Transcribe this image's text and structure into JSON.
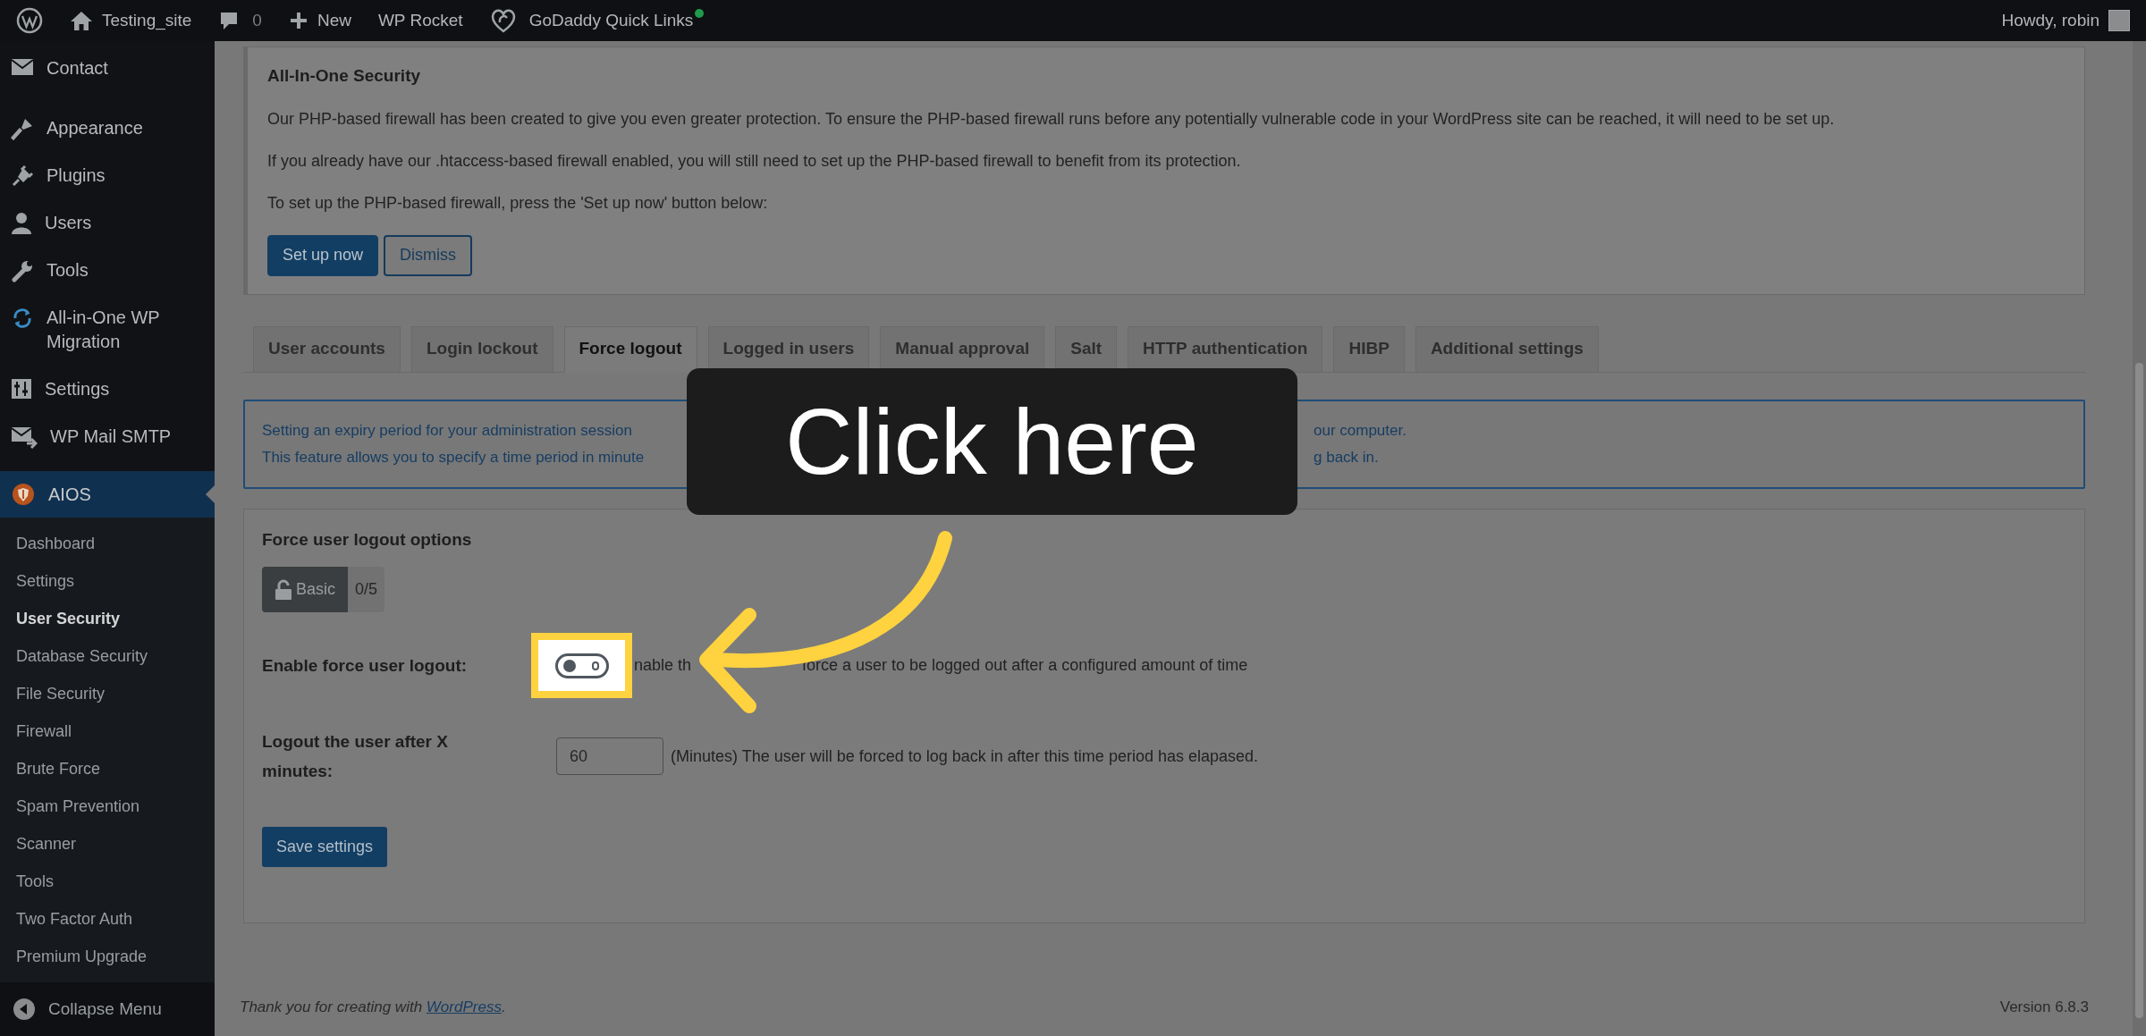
{
  "admin_bar": {
    "site": "Testing_site",
    "comments": "0",
    "new": "New",
    "rocket": "WP Rocket",
    "quick_links": "GoDaddy Quick Links",
    "greeting": "Howdy, robin"
  },
  "sidebar": {
    "items": [
      {
        "label": "Contact",
        "selected": false
      },
      {
        "label": "Appearance",
        "selected": false
      },
      {
        "label": "Plugins",
        "selected": false
      },
      {
        "label": "Users",
        "selected": false
      },
      {
        "label": "Tools",
        "selected": false
      },
      {
        "label": "All-in-One WP Migration",
        "selected": false
      },
      {
        "label": "Settings",
        "selected": false
      },
      {
        "label": "WP Mail SMTP",
        "selected": false
      }
    ],
    "current": {
      "label": "AIOS",
      "selected": true
    },
    "submenu": [
      {
        "label": "Dashboard",
        "selected": false
      },
      {
        "label": "Settings",
        "selected": false
      },
      {
        "label": "User Security",
        "selected": true
      },
      {
        "label": "Database Security",
        "selected": false
      },
      {
        "label": "File Security",
        "selected": false
      },
      {
        "label": "Firewall",
        "selected": false
      },
      {
        "label": "Brute Force",
        "selected": false
      },
      {
        "label": "Spam Prevention",
        "selected": false
      },
      {
        "label": "Scanner",
        "selected": false
      },
      {
        "label": "Tools",
        "selected": false
      },
      {
        "label": "Two Factor Auth",
        "selected": false
      },
      {
        "label": "Premium Upgrade",
        "selected": false
      }
    ],
    "collapse": "Collapse Menu"
  },
  "notice": {
    "title": "All-In-One Security",
    "paragraphs": [
      "Our PHP-based firewall has been created to give you even greater protection. To ensure the PHP-based firewall runs before any potentially vulnerable code in your WordPress site can be reached, it will need to be set up.",
      "If you already have our .htaccess-based firewall enabled, you will still need to set up the PHP-based firewall to benefit from its protection.",
      "To set up the PHP-based firewall, press the 'Set up now' button below:"
    ],
    "buttons": [
      {
        "label": "Set up now",
        "kind": "primary"
      },
      {
        "label": "Dismiss",
        "kind": "secondary"
      }
    ]
  },
  "tabs": [
    {
      "label": "User accounts",
      "selected": false
    },
    {
      "label": "Login lockout",
      "selected": false
    },
    {
      "label": "Force logout",
      "selected": true
    },
    {
      "label": "Logged in users",
      "selected": false
    },
    {
      "label": "Manual approval",
      "selected": false
    },
    {
      "label": "Salt",
      "selected": false
    },
    {
      "label": "HTTP authentication",
      "selected": false
    },
    {
      "label": "HIBP",
      "selected": false
    },
    {
      "label": "Additional settings",
      "selected": false
    }
  ],
  "info": {
    "lines": [
      {
        "left": "Setting an expiry period for your administration session",
        "right": "our computer."
      },
      {
        "left": "This feature allows you to specify a time period in minute",
        "right": "g back in."
      }
    ]
  },
  "options": {
    "title": "Force user logout options",
    "badge": {
      "label": "Basic",
      "score": "0/5"
    },
    "fields": [
      {
        "kind": "toggle",
        "label": "Enable force user logout:",
        "on": false,
        "description_parts": [
          "nable th",
          "force a user to be logged out after a configured amount of time"
        ]
      },
      {
        "kind": "number",
        "label": "Logout the user after X minutes:",
        "value": "60",
        "description": "(Minutes) The user will be forced to log back in after this time period has elapased."
      }
    ],
    "save": "Save settings"
  },
  "footer": {
    "thanks": "Thank you for creating with ",
    "link": "WordPress",
    "end": ".",
    "version": "Version 6.8.3"
  },
  "callout": {
    "text": "Click here"
  }
}
